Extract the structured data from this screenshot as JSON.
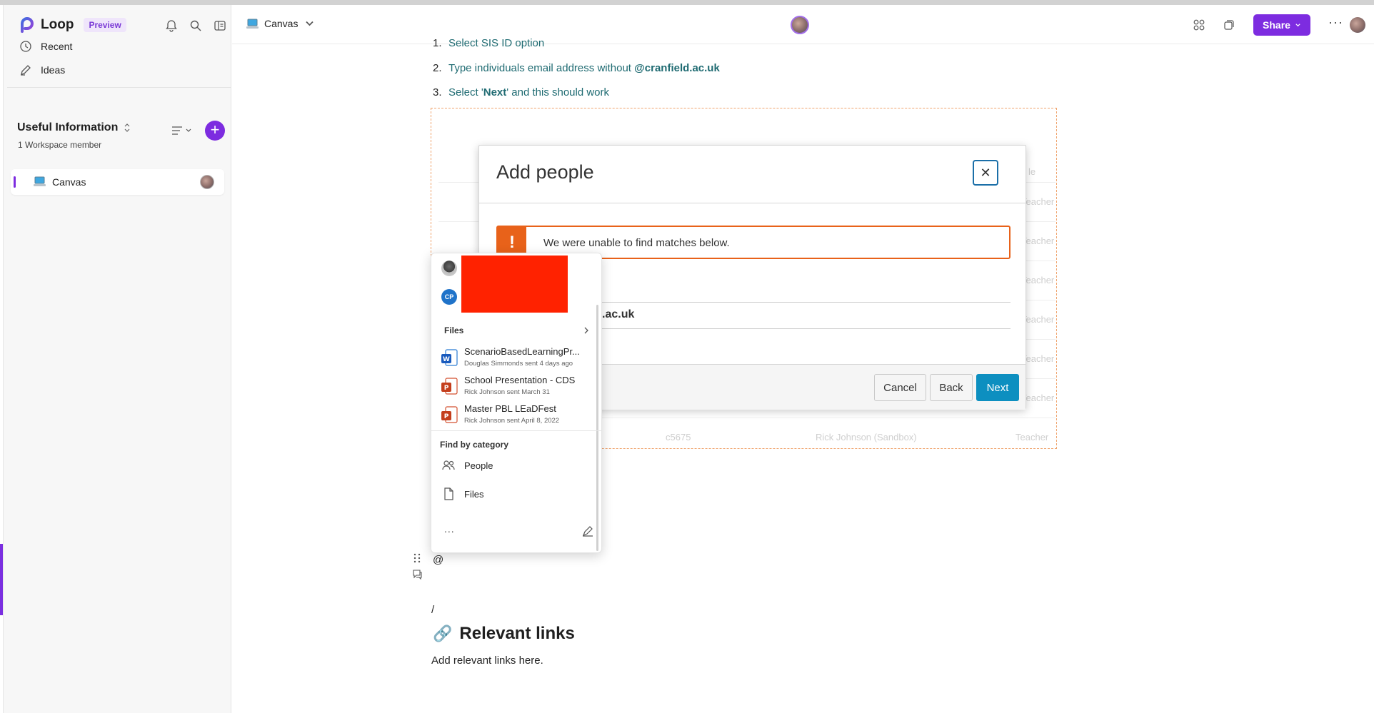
{
  "app": {
    "name": "Loop",
    "badge": "Preview"
  },
  "sidebar": {
    "nav": [
      {
        "label": "Recent",
        "icon": "clock-icon"
      },
      {
        "label": "Ideas",
        "icon": "pencil-icon"
      }
    ],
    "workspace": {
      "title": "Useful Information",
      "members": "1 Workspace member"
    },
    "pages": [
      {
        "label": "Canvas",
        "active": true
      }
    ]
  },
  "topbar": {
    "breadcrumb": "Canvas",
    "share_label": "Share"
  },
  "content": {
    "steps": [
      {
        "num": "1.",
        "text_a": "Select SIS ID option",
        "bold": "",
        "text_b": ""
      },
      {
        "num": "2.",
        "text_a": "Type individuals email address without ",
        "bold": "@cranfield.ac.uk",
        "text_b": ""
      },
      {
        "num": "3.",
        "text_a": "Select '",
        "bold": "Next",
        "text_b": "' and this should work"
      }
    ],
    "background_table": {
      "header_fragment": "le",
      "role": "Teacher",
      "last_row": {
        "id": "c5675",
        "name": "Rick Johnson (Sandbox)",
        "role": "Teacher"
      }
    },
    "at_symbol": "@",
    "slash": "/",
    "heading": "Relevant links",
    "heading_icon": "🔗",
    "paragraph": "Add relevant links here."
  },
  "modal": {
    "title": "Add people",
    "close": "✕",
    "alert_icon": "!",
    "alert": "We were unable to find matches below.",
    "field_value": ".ac.uk",
    "buttons": {
      "cancel": "Cancel",
      "back": "Back",
      "next": "Next"
    }
  },
  "mention_popup": {
    "people_initials": "CP",
    "files_heading": "Files",
    "files": [
      {
        "name": "ScenarioBasedLearningPr...",
        "sub": "Douglas Simmonds sent 4 days ago",
        "type": "word"
      },
      {
        "name": "School Presentation - CDS",
        "sub": "Rick Johnson sent March 31",
        "type": "powerpoint"
      },
      {
        "name": "Master PBL LEaDFest",
        "sub": "Rick Johnson sent April 8, 2022",
        "type": "powerpoint"
      }
    ],
    "category_heading": "Find by category",
    "categories": [
      {
        "label": "People",
        "icon": "people-icon"
      },
      {
        "label": "Files",
        "icon": "document-icon"
      }
    ],
    "more": "..."
  },
  "colors": {
    "brand": "#7d2ce0",
    "step_text": "#1f6b72",
    "alert": "#e8621a",
    "next_button": "#0d8fc0",
    "redaction": "#ff2200"
  }
}
